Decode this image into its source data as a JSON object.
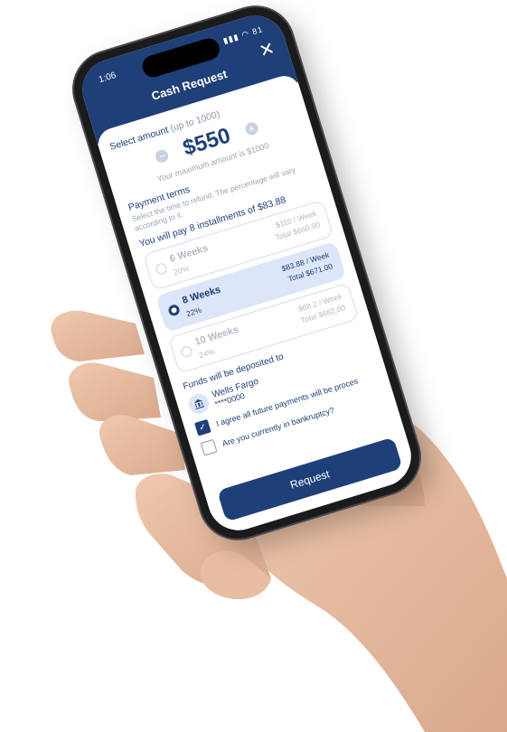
{
  "status": {
    "time": "1:06",
    "icons": "▮▮▮ ◠ 81"
  },
  "header": {
    "title": "Cash Request",
    "close_icon": "close-icon"
  },
  "amount": {
    "label": "Select amount",
    "limit": "(up to 1000)",
    "value": "$550",
    "max_text": "Your maximum amount is $1000",
    "decrement": "−",
    "increment": "+"
  },
  "terms": {
    "title": "Payment terms",
    "description": "Select the time to refund. The percentage will vary according to it.",
    "summary": "You will pay 8 installments of $83.88",
    "options": [
      {
        "weeks": "6 Weeks",
        "pct": "20%",
        "per_week": "$110 / Week",
        "total": "Total $660.00",
        "selected": false
      },
      {
        "weeks": "8 Weeks",
        "pct": "22%",
        "per_week": "$83.88 / Week",
        "total": "Total $671.00",
        "selected": true
      },
      {
        "weeks": "10 Weeks",
        "pct": "24%",
        "per_week": "$68.2 / Week",
        "total": "Total $682.00",
        "selected": false
      }
    ]
  },
  "funds": {
    "label": "Funds will be deposited to",
    "bank_name": "Wells Fargo",
    "account": "****0000",
    "bank_icon": "bank-icon"
  },
  "agreements": {
    "future_payments": "I agree all future payments will be proces",
    "bankruptcy": "Are you currently in bankruptcy?",
    "future_payments_checked": true,
    "bankruptcy_checked": false
  },
  "request_button": "Request",
  "colors": {
    "primary": "#1f3f78",
    "selected_bg": "#dde6f8",
    "muted": "#9aa3b3"
  }
}
